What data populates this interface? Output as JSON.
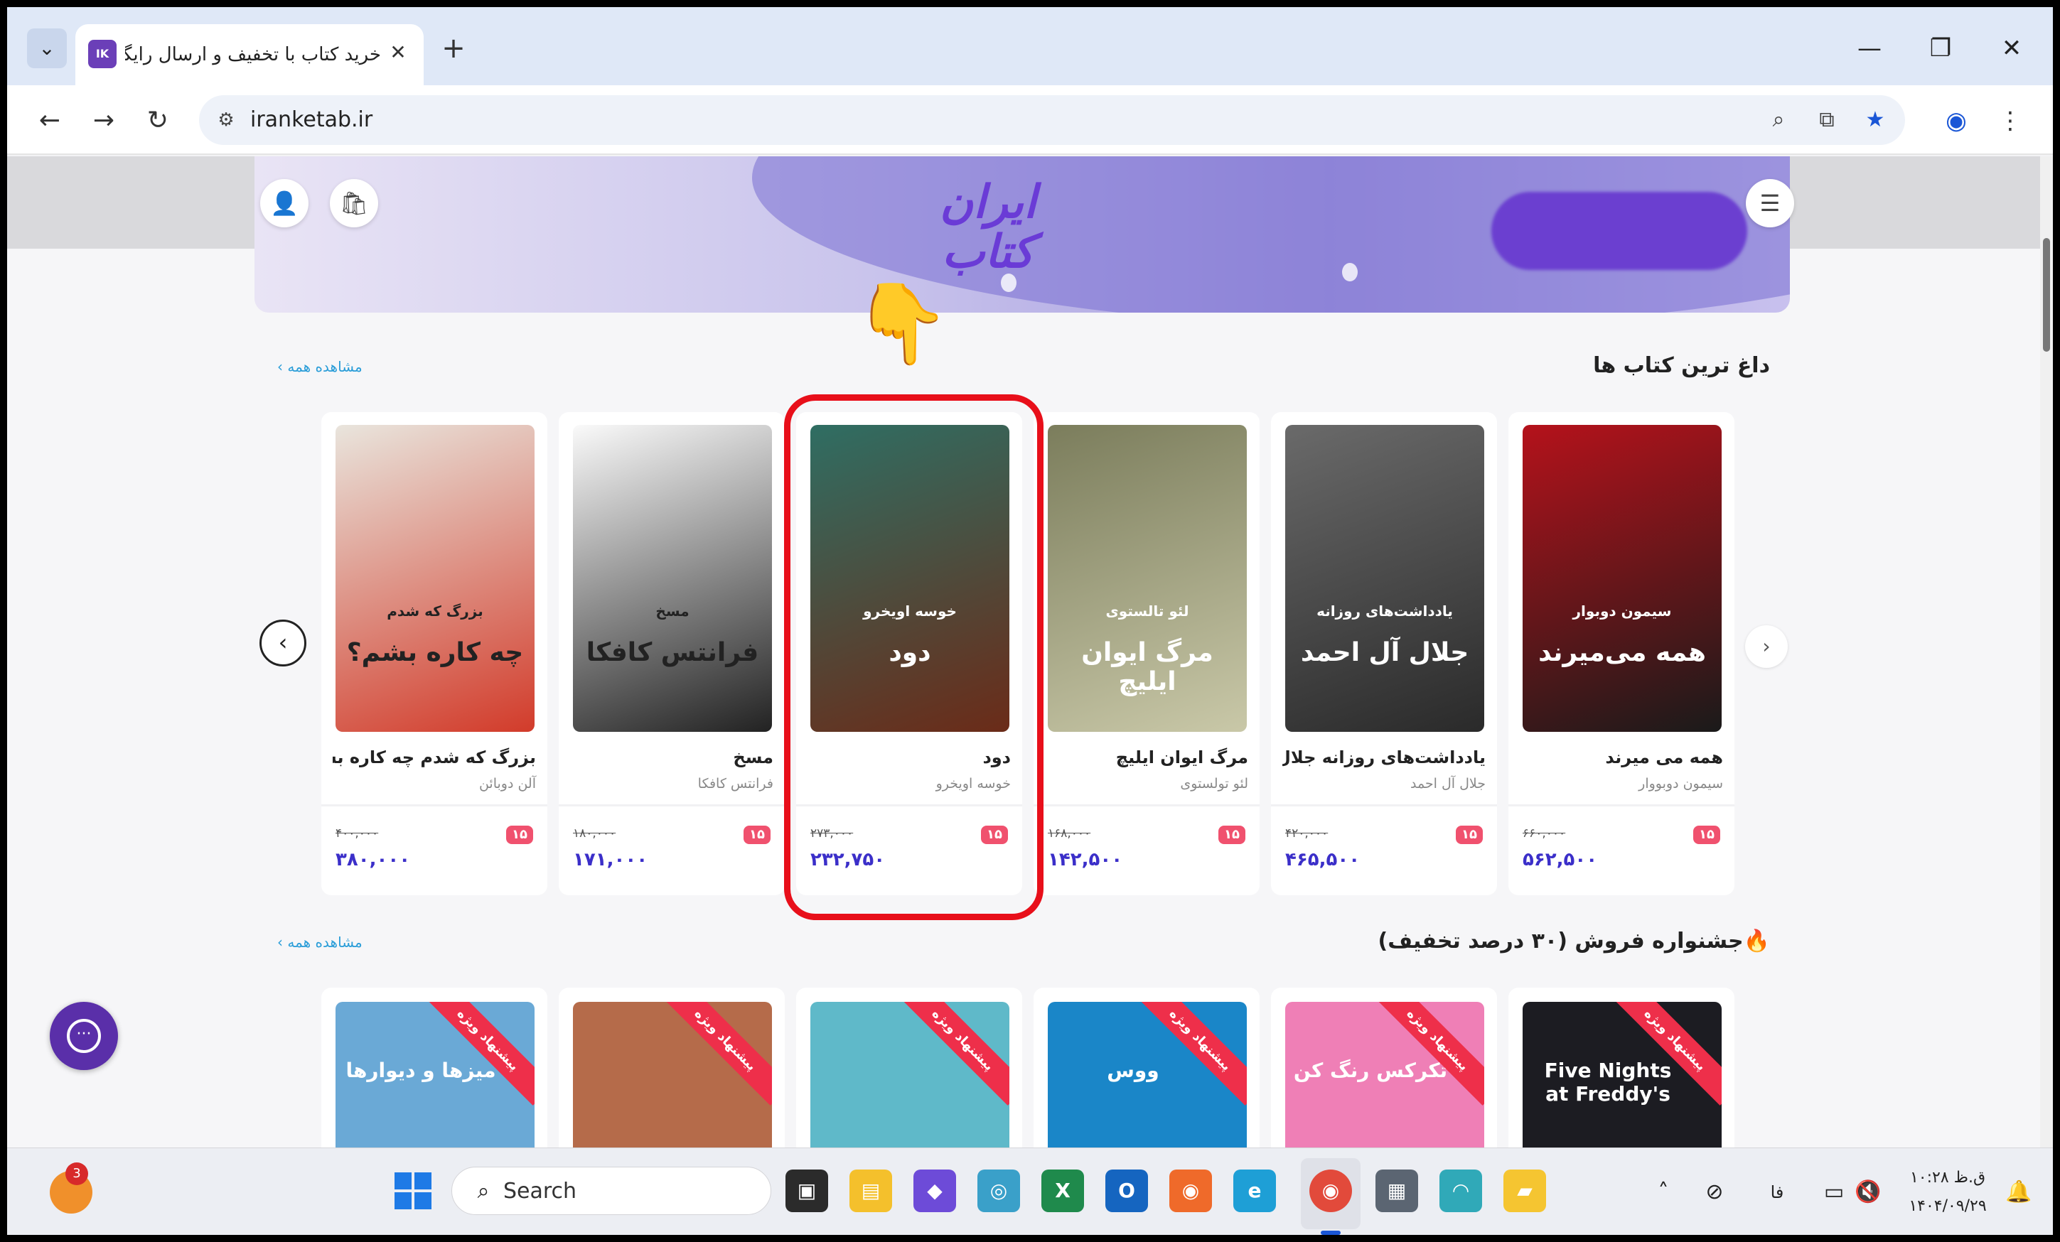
{
  "browser": {
    "tab_title": "خرید کتاب با تخفیف و ارسال رایگان",
    "url": "iranketab.ir",
    "favicon_text": "IK",
    "close_glyph": "✕",
    "new_tab_glyph": "+"
  },
  "site": {
    "logo_text": "ایران کتاب"
  },
  "sections": {
    "hot_books": {
      "title": "داغ ترین کتاب ها",
      "see_all": "مشاهده همه ›"
    },
    "festival": {
      "title": "🔥جشنواره فروش (۳۰ درصد تخفیف)",
      "see_all": "مشاهده همه ›"
    }
  },
  "hot_books": [
    {
      "title": "همه می میرند",
      "author": "سیمون دوبووار",
      "discount": "۱۵",
      "old_price": "۶۶۰,۰۰۰",
      "new_price": "۵۶۲,۵۰۰",
      "cover_lines": [
        "سیمون دوبوار",
        "همه می‌میرند"
      ],
      "colors": [
        "#b5121b",
        "#1a1a1a"
      ]
    },
    {
      "title": "یادداشت‌های روزانه جلال آل ا...",
      "author": "جلال آل احمد",
      "discount": "۱۵",
      "old_price": "۴۲۰,۰۰۰",
      "new_price": "۴۶۵,۵۰۰",
      "cover_lines": [
        "یادداشت‌های روزانه",
        "جلال آل احمد"
      ],
      "colors": [
        "#6a6a6a",
        "#2a2a2a"
      ]
    },
    {
      "title": "مرگ ایوان ایلیچ",
      "author": "لئو تولستوی",
      "discount": "۱۵",
      "old_price": "۱۶۸,۰۰۰",
      "new_price": "۱۴۲,۵۰۰",
      "cover_lines": [
        "لئو تالستوی",
        "مرگ ایوان ایلیچ"
      ],
      "colors": [
        "#7b7d5c",
        "#c9c8a8"
      ]
    },
    {
      "title": "دود",
      "author": "خوسه اویخرو",
      "discount": "۱۵",
      "old_price": "۲۷۳,۰۰۰",
      "new_price": "۲۳۲,۷۵۰",
      "cover_lines": [
        "خوسه اویخرو",
        "دود"
      ],
      "colors": [
        "#2f6e63",
        "#6b2b18"
      ]
    },
    {
      "title": "مسخ",
      "author": "فرانتس کافکا",
      "discount": "۱۵",
      "old_price": "۱۸۰,۰۰۰",
      "new_price": "۱۷۱,۰۰۰",
      "cover_lines": [
        "مسخ",
        "فرانتس کافکا"
      ],
      "colors": [
        "#fafafa",
        "#222222"
      ]
    },
    {
      "title": "بزرگ که شدم چه کاره بشم؟",
      "author": "آلن دوبائن",
      "discount": "۱۵",
      "old_price": "۴۰۰,۰۰۰",
      "new_price": "۳۸۰,۰۰۰",
      "cover_lines": [
        "بزرگ که شدم",
        "چه کاره بشم؟"
      ],
      "colors": [
        "#e9e5dd",
        "#d23b2a"
      ]
    }
  ],
  "festival_books": [
    {
      "ribbon": "پیشنهاد ویژه",
      "cover_text": "Five Nights at Freddy's",
      "color": "#1c1c22"
    },
    {
      "ribbon": "پیشنهاد ویژه",
      "cover_text": "تکرکس رنگ کن",
      "color": "#ef7fb6"
    },
    {
      "ribbon": "پیشنهاد ویژه",
      "cover_text": "ووس",
      "color": "#1a86c8"
    },
    {
      "ribbon": "پیشنهاد ویژه",
      "cover_text": "",
      "color": "#5fb9c9"
    },
    {
      "ribbon": "پیشنهاد ویژه",
      "cover_text": "",
      "color": "#b56b4a"
    },
    {
      "ribbon": "پیشنهاد ویژه",
      "cover_text": "میزها و دیوارها",
      "color": "#6aa9d6"
    }
  ],
  "taskbar": {
    "search_label": "Search",
    "weather_badge": "3",
    "clock_time": "۱۰:۲۸ ق.ظ",
    "clock_date": "۱۴۰۴/۰۹/۲۹",
    "language": "فا"
  }
}
